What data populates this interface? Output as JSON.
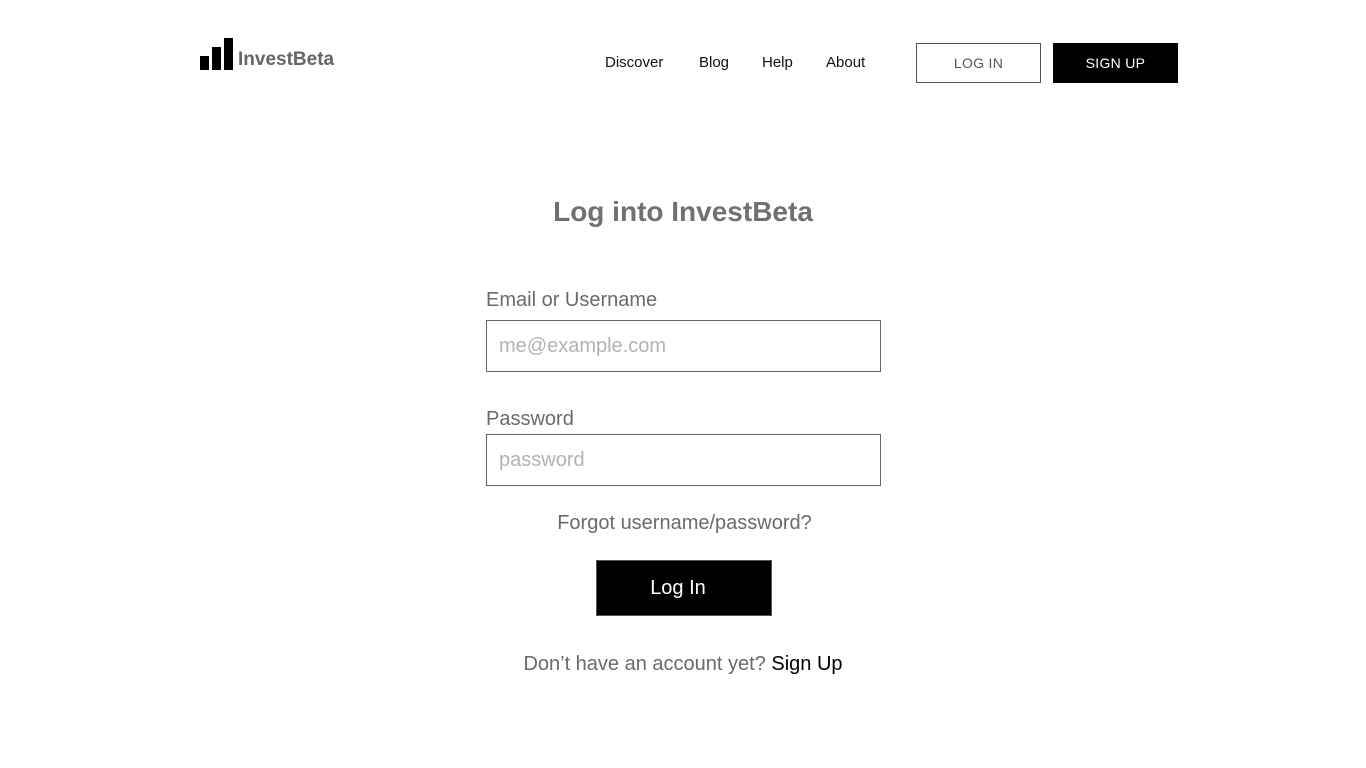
{
  "header": {
    "logo_text": "InvestBeta",
    "logo_icon": "bar-chart-icon",
    "nav": {
      "discover": "Discover",
      "blog": "Blog",
      "help": "Help",
      "about": "About"
    },
    "login_label": "LOG IN",
    "signup_label": "SIGN UP"
  },
  "form": {
    "title": "Log into InvestBeta",
    "email_label": "Email or Username",
    "email_placeholder": "me@example.com",
    "password_label": "Password",
    "password_placeholder": "password",
    "forgot_label": "Forgot username/password?",
    "submit_label": "Log In",
    "no_account_text": "Don’t have an account yet?",
    "signup_link": "Sign Up"
  },
  "colors": {
    "primary": "#000000",
    "text_muted": "#6a6a6a",
    "background": "#ffffff"
  }
}
